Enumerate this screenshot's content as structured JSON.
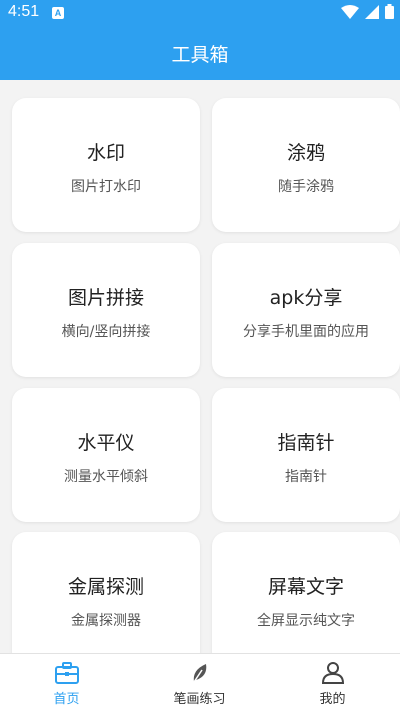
{
  "status_bar": {
    "time": "4:51",
    "notification_letter": "A"
  },
  "header": {
    "title": "工具箱"
  },
  "tools": [
    {
      "title": "水印",
      "subtitle": "图片打水印"
    },
    {
      "title": "涂鸦",
      "subtitle": "随手涂鸦"
    },
    {
      "title": "图片拼接",
      "subtitle": "横向/竖向拼接"
    },
    {
      "title": "apk分享",
      "subtitle": "分享手机里面的应用"
    },
    {
      "title": "水平仪",
      "subtitle": "测量水平倾斜"
    },
    {
      "title": "指南针",
      "subtitle": "指南针"
    },
    {
      "title": "金属探测",
      "subtitle": "金属探测器"
    },
    {
      "title": "屏幕文字",
      "subtitle": "全屏显示纯文字"
    }
  ],
  "bottom_nav": [
    {
      "label": "首页",
      "icon": "toolbox-icon",
      "active": true
    },
    {
      "label": "笔画练习",
      "icon": "leaf-icon",
      "active": false
    },
    {
      "label": "我的",
      "icon": "person-icon",
      "active": false
    }
  ],
  "colors": {
    "accent": "#2da0f0",
    "background": "#f3f3f3",
    "card": "#ffffff"
  }
}
